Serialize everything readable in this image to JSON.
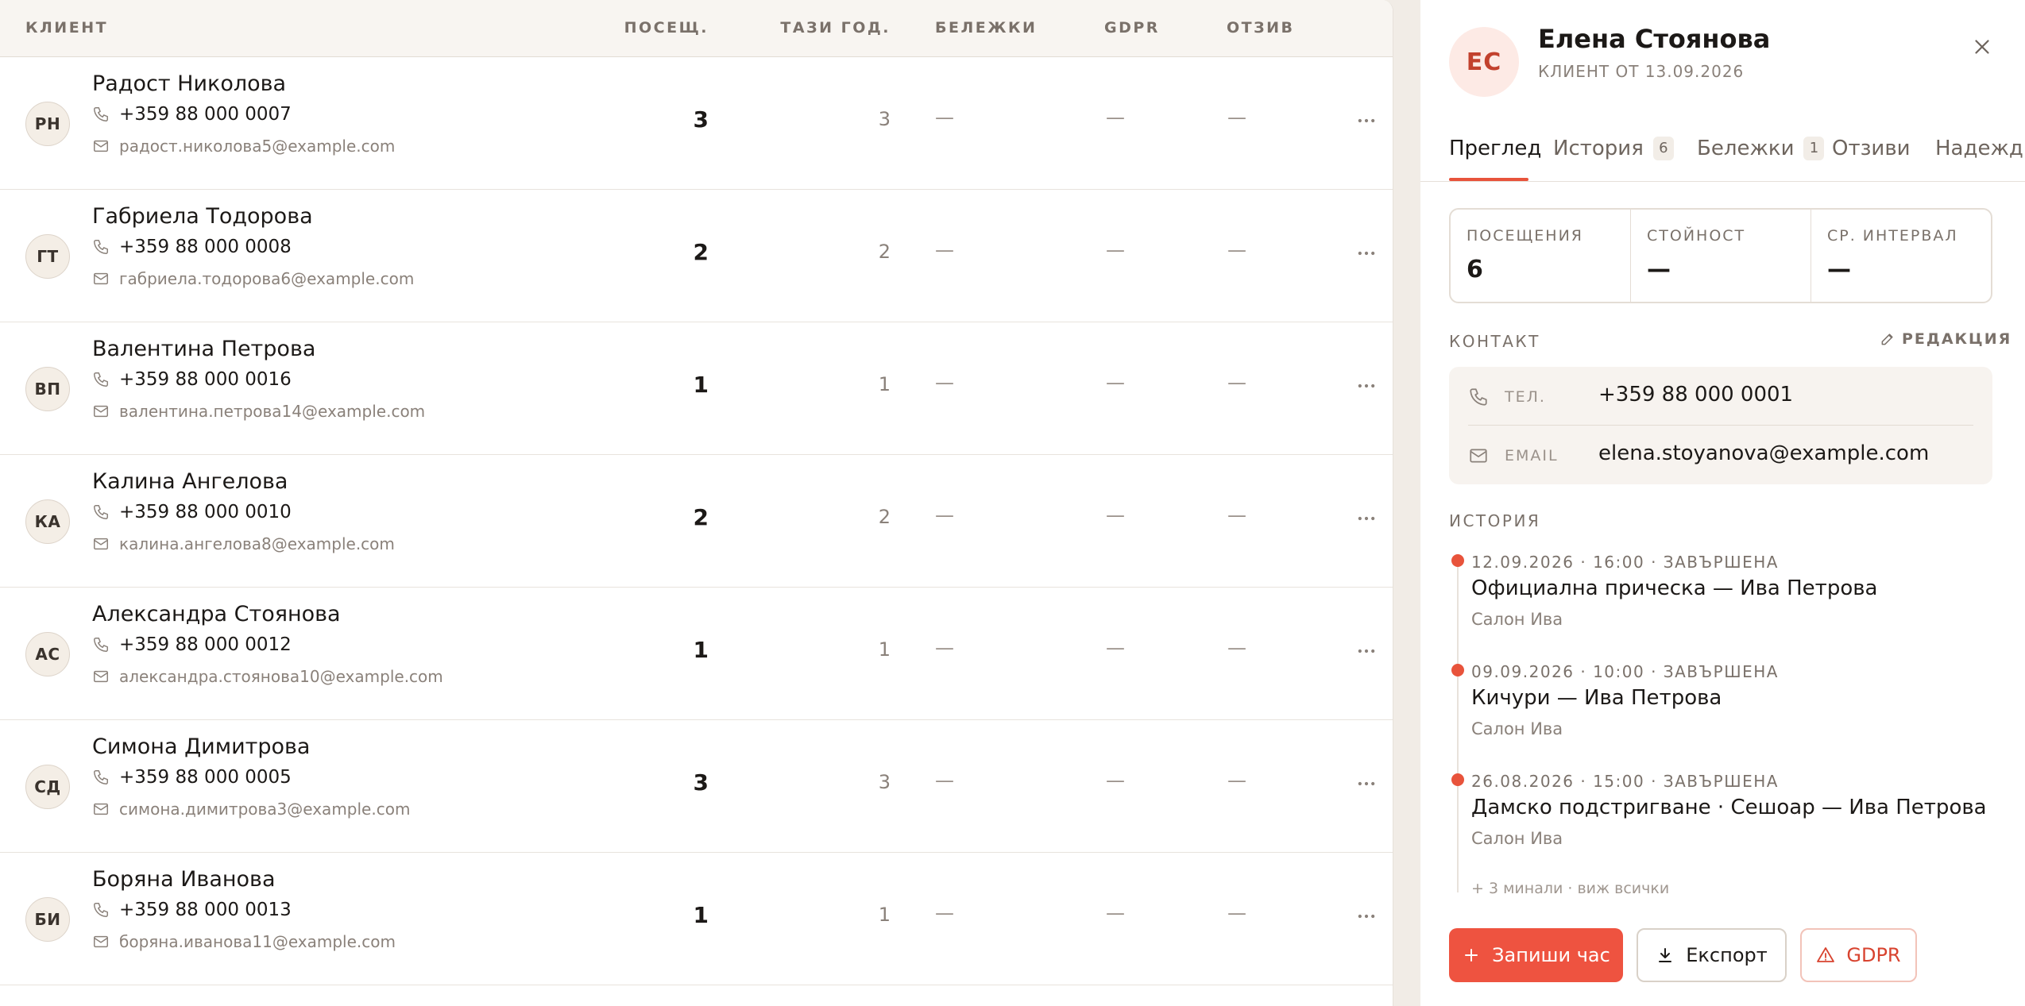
{
  "table": {
    "headers": {
      "client": "КЛИЕНТ",
      "visits": "ПОСЕЩ.",
      "this_year": "ТАЗИ ГОД.",
      "notes": "БЕЛЕЖКИ",
      "gdpr": "GDPR",
      "review": "ОТЗИВ"
    },
    "rows": [
      {
        "initials": "РН",
        "name": "Радост Николова",
        "phone": "+359 88 000 0007",
        "email": "радост.николова5@example.com",
        "visits": "3",
        "this_year": "3",
        "notes": "—",
        "gdpr": "—",
        "review": "—"
      },
      {
        "initials": "ГТ",
        "name": "Габриела Тодорова",
        "phone": "+359 88 000 0008",
        "email": "габриела.тодорова6@example.com",
        "visits": "2",
        "this_year": "2",
        "notes": "—",
        "gdpr": "—",
        "review": "—"
      },
      {
        "initials": "ВП",
        "name": "Валентина Петрова",
        "phone": "+359 88 000 0016",
        "email": "валентина.петрова14@example.com",
        "visits": "1",
        "this_year": "1",
        "notes": "—",
        "gdpr": "—",
        "review": "—"
      },
      {
        "initials": "КА",
        "name": "Калина Ангелова",
        "phone": "+359 88 000 0010",
        "email": "калина.ангелова8@example.com",
        "visits": "2",
        "this_year": "2",
        "notes": "—",
        "gdpr": "—",
        "review": "—"
      },
      {
        "initials": "АС",
        "name": "Александра Стоянова",
        "phone": "+359 88 000 0012",
        "email": "александра.стоянова10@example.com",
        "visits": "1",
        "this_year": "1",
        "notes": "—",
        "gdpr": "—",
        "review": "—"
      },
      {
        "initials": "СД",
        "name": "Симона Димитрова",
        "phone": "+359 88 000 0005",
        "email": "симона.димитрова3@example.com",
        "visits": "3",
        "this_year": "3",
        "notes": "—",
        "gdpr": "—",
        "review": "—"
      },
      {
        "initials": "БИ",
        "name": "Боряна Иванова",
        "phone": "+359 88 000 0013",
        "email": "боряна.иванова11@example.com",
        "visits": "1",
        "this_year": "1",
        "notes": "—",
        "gdpr": "—",
        "review": "—"
      }
    ]
  },
  "panel": {
    "initials": "ЕС",
    "name": "Елена Стоянова",
    "client_since": "КЛИЕНТ ОТ 13.09.2026",
    "tabs": {
      "overview": "Преглед",
      "history": "История",
      "history_count": "6",
      "notes": "Бележки",
      "notes_count": "1",
      "reviews": "Отзиви",
      "reliability": "Надеждн"
    },
    "stats": {
      "visits_label": "ПОСЕЩЕНИЯ",
      "visits_value": "6",
      "value_label": "СТОЙНОСТ",
      "value_value": "—",
      "interval_label": "СР. ИНТЕРВАЛ",
      "interval_value": "—"
    },
    "contact": {
      "title": "КОНТАКТ",
      "edit": "РЕДАКЦИЯ",
      "phone_label": "ТЕЛ.",
      "phone": "+359 88 000 0001",
      "email_label": "EMAIL",
      "email": "elena.stoyanova@example.com"
    },
    "history": {
      "title": "ИСТОРИЯ",
      "items": [
        {
          "meta": "12.09.2026 · 16:00 · ЗАВЪРШЕНА",
          "title": "Официална прическа — Ива Петрова",
          "location": "Салон Ива"
        },
        {
          "meta": "09.09.2026 · 10:00 · ЗАВЪРШЕНА",
          "title": "Кичури — Ива Петрова",
          "location": "Салон Ива"
        },
        {
          "meta": "26.08.2026 · 15:00 · ЗАВЪРШЕНА",
          "title": "Дамско подстригване · Сешоар — Ива Петрова",
          "location": "Салон Ива"
        }
      ],
      "more": "+ 3 минали · виж всички"
    },
    "buttons": {
      "book": "Запиши час",
      "export": "Експорт",
      "gdpr": "GDPR"
    }
  },
  "colors": {
    "accent": "#EE5340",
    "page_background": "#F1ECE6",
    "header_background": "#F8F5F1"
  },
  "icons": [
    "phone-icon",
    "mail-icon",
    "more-icon",
    "close-icon",
    "pencil-icon",
    "plus-icon",
    "download-icon",
    "warning-icon"
  ]
}
